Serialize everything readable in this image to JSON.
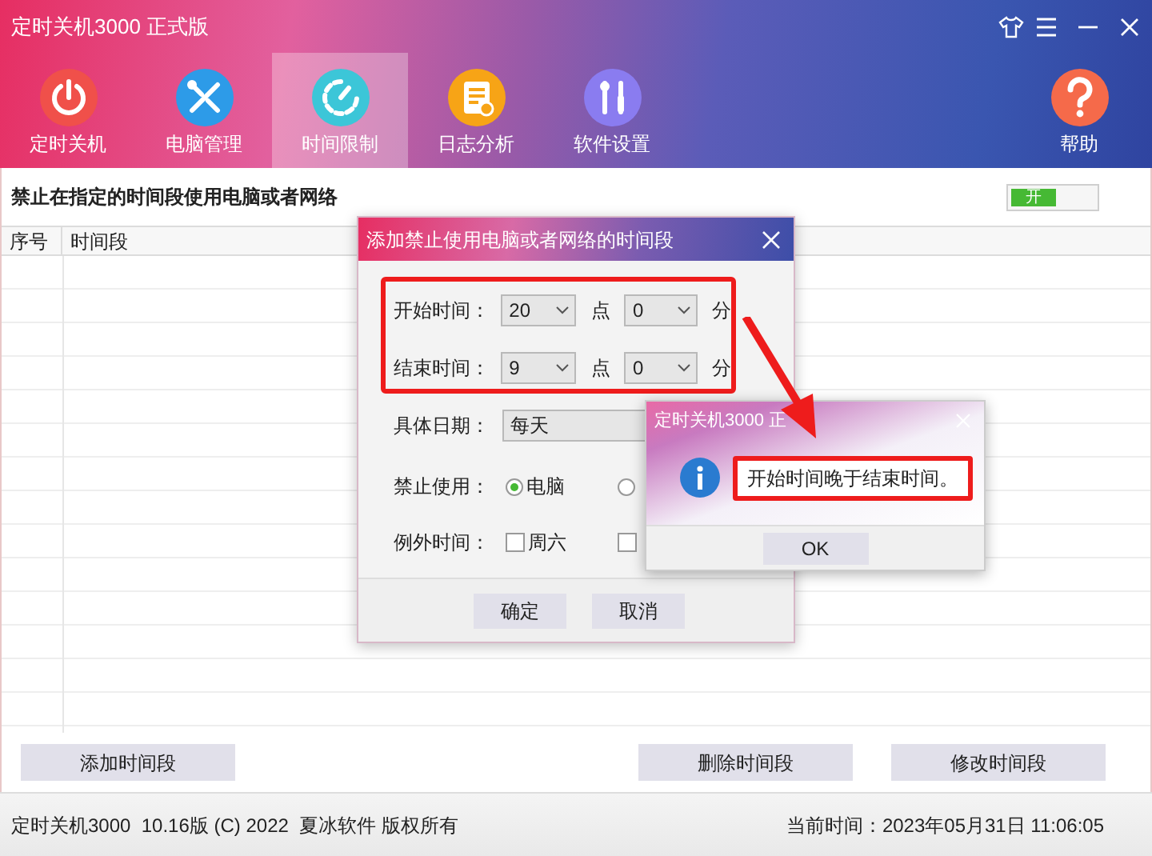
{
  "window": {
    "title": "定时关机3000 正式版"
  },
  "nav": [
    {
      "label": "定时关机",
      "kind": "power",
      "selected": false
    },
    {
      "label": "电脑管理",
      "kind": "tools",
      "selected": false
    },
    {
      "label": "时间限制",
      "kind": "timer",
      "selected": true
    },
    {
      "label": "日志分析",
      "kind": "log",
      "selected": false
    },
    {
      "label": "软件设置",
      "kind": "settings",
      "selected": false
    },
    {
      "label": "帮助",
      "kind": "help",
      "selected": false
    }
  ],
  "rule": {
    "heading": "禁止在指定的时间段使用电脑或者网络",
    "toggle": {
      "label": "开",
      "on": true
    }
  },
  "table": {
    "columns": [
      "序号",
      "时间段"
    ]
  },
  "buttons": [
    "添加时间段",
    "删除时间段",
    "修改时间段"
  ],
  "status_bar": {
    "copyright": "定时关机3000  10.16版 (C) 2022  夏冰软件 版权所有",
    "time_label": "当前时间：",
    "time": "2023年05月31日 11:06:05"
  },
  "dialog": {
    "title": "添加禁止使用电脑或者网络的时间段",
    "times": [
      {
        "label": "开始时间：",
        "hour": "20",
        "hour_unit": "点",
        "minute": "0",
        "minute_unit": "分"
      },
      {
        "label": "结束时间：",
        "hour": "9",
        "hour_unit": "点",
        "minute": "0",
        "minute_unit": "分"
      }
    ],
    "date": {
      "label": "具体日期：",
      "value": "每天"
    },
    "block": {
      "label": "禁止使用：",
      "options": [
        {
          "label": "电脑",
          "selected": true
        },
        {
          "selected": false
        }
      ]
    },
    "exceptions": {
      "label": "例外时间：",
      "options": [
        {
          "label": "周六",
          "checked": false
        },
        {
          "checked": false
        }
      ]
    },
    "buttons": [
      "确定",
      "取消"
    ]
  },
  "message": {
    "title": "定时关机3000 正",
    "text": "开始时间晚于结束时间。",
    "button": "OK"
  }
}
